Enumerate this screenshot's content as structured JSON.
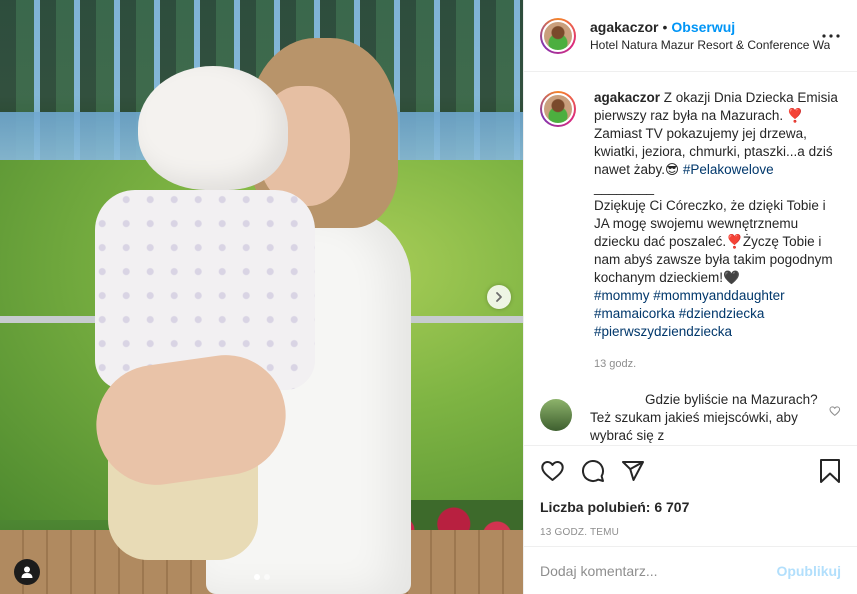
{
  "header": {
    "username": "agakaczor",
    "separator": "•",
    "follow_label": "Obserwuj",
    "location": "Hotel Natura Mazur Resort & Conference Warmia"
  },
  "caption": {
    "username": "agakaczor",
    "text_1": " Z okazji Dnia Dziecka Emisia pierwszy raz była na Mazurach. ❣️ Zamiast TV pokazujemy jej drzewa, kwiatki, jeziora, chmurki, ptaszki...a dziś nawet żaby.😎 ",
    "hashtag_1": "#Pelakowelove",
    "divider": "________",
    "text_2": "Dziękuję Ci Córeczko, że dzięki Tobie i JA mogę swojemu wewnętrznemu dziecku dać poszaleć.❣️Życzę Tobie i nam abyś zawsze była takim pogodnym kochanym dzieckiem!🖤",
    "hashtags_a": [
      "#mommy",
      "#mommyanddaughter"
    ],
    "hashtags_b": [
      "#mamaicorka",
      "#dziendziecka"
    ],
    "hashtags_c": [
      "#pierwszydziendziecka"
    ],
    "time": "13 godz."
  },
  "reply": {
    "username": "",
    "text": "Gdzie byliście na Mazurach? Też szukam jakieś miejscówki, aby wybrać się z"
  },
  "actions": {
    "likes": "Liczba polubień: 6 707",
    "post_time": "13 GODZ. TEMU"
  },
  "comment_box": {
    "placeholder": "Dodaj komentarz...",
    "publish_label": "Opublikuj"
  },
  "carousel": {
    "count": 2,
    "active_index": 0
  },
  "colors": {
    "link_blue": "#0095f6",
    "hashtag": "#00376b",
    "muted": "#8e8e8e",
    "publish_disabled": "#b2dffc"
  },
  "icons": [
    "tag-user-icon",
    "chevron-right-icon",
    "more-options-icon",
    "heart-icon",
    "comment-icon",
    "share-icon",
    "bookmark-icon"
  ]
}
